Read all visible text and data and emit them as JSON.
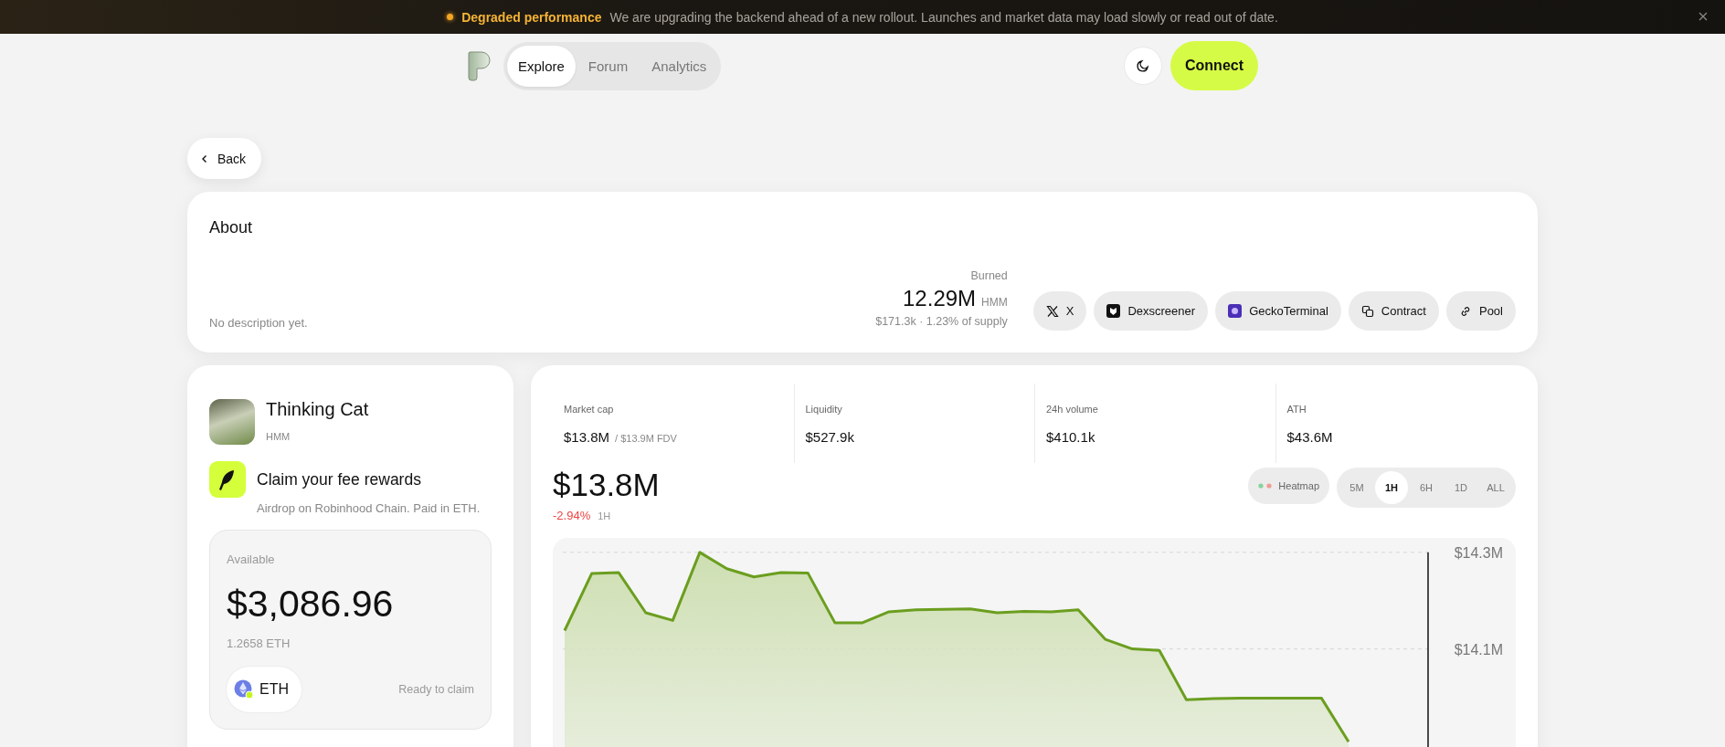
{
  "banner": {
    "title": "Degraded performance",
    "message": "We are upgrading the backend ahead of a new rollout. Launches and market data may load slowly or read out of date."
  },
  "nav": {
    "tabs": [
      {
        "label": "Explore",
        "selected": true
      },
      {
        "label": "Forum",
        "selected": false
      },
      {
        "label": "Analytics",
        "selected": false
      }
    ],
    "connect": "Connect"
  },
  "back": "Back",
  "about": {
    "title": "About",
    "description": "No description yet.",
    "burned": {
      "label": "Burned",
      "amount": "12.29M",
      "unit": "HMM",
      "detail": "$171.3k · 1.23% of supply"
    },
    "links": [
      {
        "kind": "x",
        "label": "X"
      },
      {
        "kind": "dexscreener",
        "label": "Dexscreener"
      },
      {
        "kind": "gecko",
        "label": "GeckoTerminal"
      },
      {
        "kind": "contract",
        "label": "Contract"
      },
      {
        "kind": "pool",
        "label": "Pool"
      }
    ]
  },
  "token": {
    "name": "Thinking Cat",
    "symbol": "HMM"
  },
  "rewards": {
    "title": "Claim your fee rewards",
    "subtitle": "Airdrop on Robinhood Chain. Paid in ETH.",
    "available_label": "Available",
    "amount": "$3,086.96",
    "eth_amount": "1.2658 ETH",
    "asset": "ETH",
    "status": "Ready to claim"
  },
  "stats": [
    {
      "label": "Market cap",
      "value": "$13.8M",
      "sub": "/ $13.9M FDV"
    },
    {
      "label": "Liquidity",
      "value": "$527.9k"
    },
    {
      "label": "24h volume",
      "value": "$410.1k"
    },
    {
      "label": "ATH",
      "value": "$43.6M"
    }
  ],
  "price": {
    "value": "$13.8M",
    "change": "-2.94%",
    "period": "1H"
  },
  "heatmap": "Heatmap",
  "ranges": [
    {
      "label": "5M",
      "selected": false
    },
    {
      "label": "1H",
      "selected": true
    },
    {
      "label": "6H",
      "selected": false
    },
    {
      "label": "1D",
      "selected": false
    },
    {
      "label": "ALL",
      "selected": false
    }
  ],
  "chart_data": {
    "type": "area",
    "ylim": [
      13.88,
      14.33
    ],
    "yticks": [
      {
        "value": 14.3,
        "label": "$14.3M"
      },
      {
        "value": 14.1,
        "label": "$14.1M"
      }
    ],
    "series": [
      {
        "color": "#6b9e1f",
        "values": [
          14.138,
          14.256,
          14.258,
          14.175,
          14.159,
          14.3,
          14.266,
          14.249,
          14.258,
          14.257,
          14.154,
          14.154,
          14.177,
          14.181,
          14.182,
          14.183,
          14.175,
          14.178,
          14.177,
          14.181,
          14.12,
          14.1,
          14.097,
          13.995,
          13.997,
          13.998,
          13.998,
          13.998,
          13.998,
          13.908
        ]
      }
    ]
  }
}
